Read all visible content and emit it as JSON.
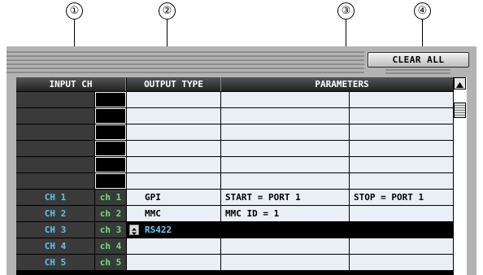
{
  "callouts": [
    "①",
    "②",
    "③",
    "④"
  ],
  "clear_all_label": "CLEAR ALL",
  "headers": {
    "input_ch": "INPUT CH",
    "output_type": "OUTPUT TYPE",
    "parameters": "PARAMETERS"
  },
  "spinner_icon": "up-down-arrows-icon",
  "scroll_up_icon": "triangle-up-icon",
  "rows": [
    {
      "label": "",
      "ch": "",
      "type": "",
      "p1": "",
      "p2": ""
    },
    {
      "label": "",
      "ch": "",
      "type": "",
      "p1": "",
      "p2": ""
    },
    {
      "label": "",
      "ch": "",
      "type": "",
      "p1": "",
      "p2": ""
    },
    {
      "label": "",
      "ch": "",
      "type": "",
      "p1": "",
      "p2": ""
    },
    {
      "label": "",
      "ch": "",
      "type": "",
      "p1": "",
      "p2": ""
    },
    {
      "label": "",
      "ch": "",
      "type": "",
      "p1": "",
      "p2": ""
    },
    {
      "label": "CH 1",
      "ch": "ch 1",
      "type": "GPI",
      "p1": "START = PORT 1",
      "p2": "STOP = PORT 1"
    },
    {
      "label": "CH 2",
      "ch": "ch 2",
      "type": "MMC",
      "p1": "MMC ID =   1",
      "p2": ""
    },
    {
      "label": "CH 3",
      "ch": "ch 3",
      "type": "RS422",
      "p1": "",
      "p2": "",
      "selected": true
    },
    {
      "label": "CH 4",
      "ch": "ch 4",
      "type": "",
      "p1": "",
      "p2": ""
    },
    {
      "label": "CH 5",
      "ch": "ch 5",
      "type": "",
      "p1": "",
      "p2": ""
    }
  ],
  "colors": {
    "label": "#5fc4f0",
    "ch_green": "#6ee36e",
    "selected_text": "#6fd0ff",
    "cell_bg": "#e9eff4"
  }
}
